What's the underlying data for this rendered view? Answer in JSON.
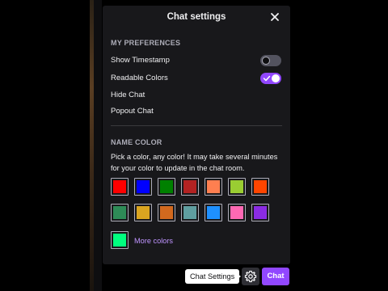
{
  "panel": {
    "title": "Chat settings"
  },
  "preferences": {
    "section_label": "MY PREFERENCES",
    "show_timestamp": {
      "label": "Show Timestamp",
      "enabled": false
    },
    "readable_colors": {
      "label": "Readable Colors",
      "enabled": true
    },
    "hide_chat": {
      "label": "Hide Chat"
    },
    "popout_chat": {
      "label": "Popout Chat"
    }
  },
  "name_color": {
    "section_label": "NAME COLOR",
    "description": "Pick a color, any color! It may take several minutes for your color to update in the chat room.",
    "swatches_row1": [
      "#ff0000",
      "#0000ff",
      "#008000",
      "#b22222",
      "#ff7f50",
      "#9acd32",
      "#ff4500"
    ],
    "swatches_row2": [
      "#2e8b57",
      "#daa520",
      "#d2691e",
      "#5f9ea0",
      "#1e90ff",
      "#ff69b4",
      "#8a2be2"
    ],
    "custom_swatch": "#00ff7f",
    "more_colors_label": "More colors"
  },
  "footer": {
    "tooltip": "Chat Settings",
    "settings_icon": "gear-icon",
    "chat_button_label": "Chat"
  },
  "colors": {
    "accent": "#9147ff",
    "panel_bg": "#18181b",
    "link": "#bf94ff"
  }
}
